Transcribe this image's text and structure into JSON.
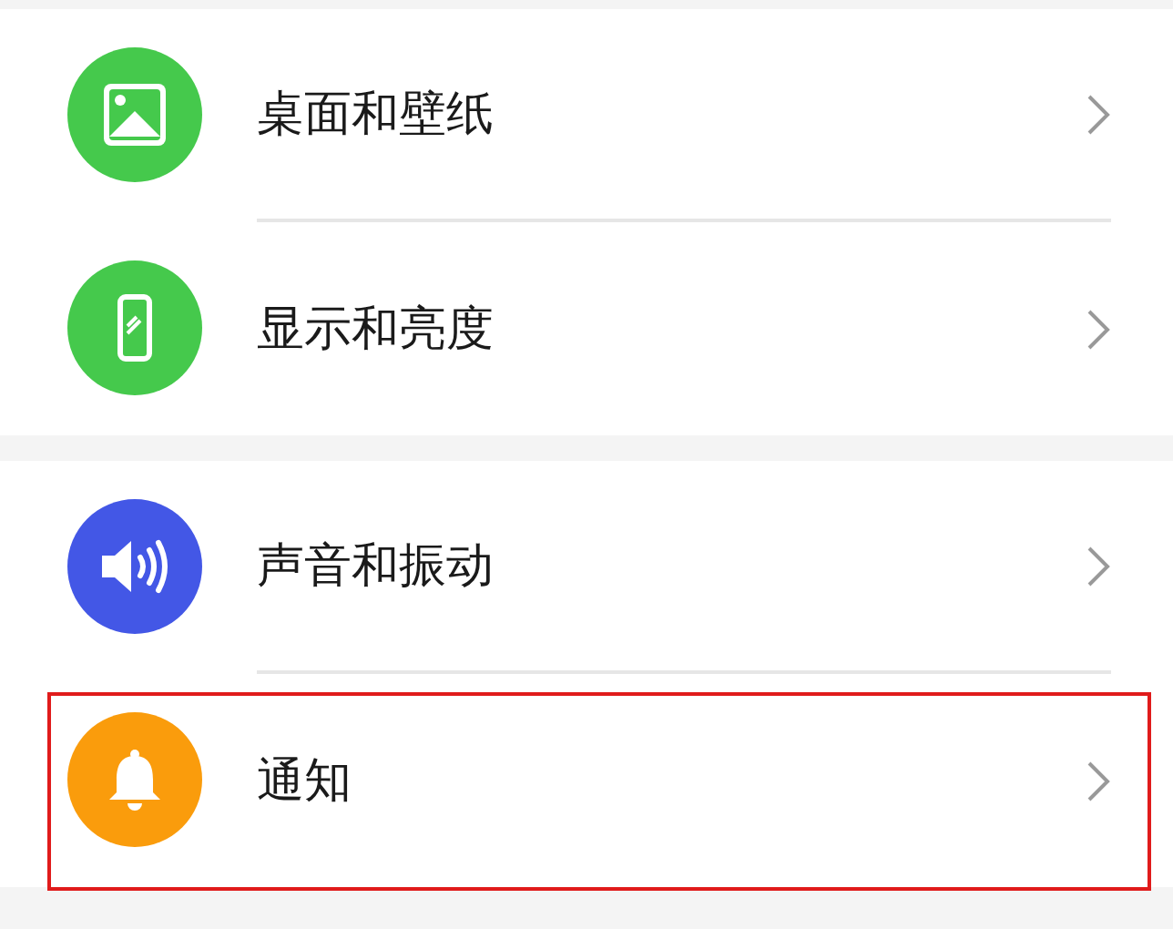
{
  "groups": [
    {
      "items": [
        {
          "label": "桌面和壁纸",
          "kind": "image",
          "color": "#45c94c",
          "highlighted": false
        },
        {
          "label": "显示和亮度",
          "kind": "phone",
          "color": "#45c94c",
          "highlighted": false
        }
      ]
    },
    {
      "items": [
        {
          "label": "声音和振动",
          "kind": "speaker",
          "color": "#4357e6",
          "highlighted": false
        },
        {
          "label": "通知",
          "kind": "bell",
          "color": "#fa9c0c",
          "highlighted": true
        }
      ]
    }
  ]
}
